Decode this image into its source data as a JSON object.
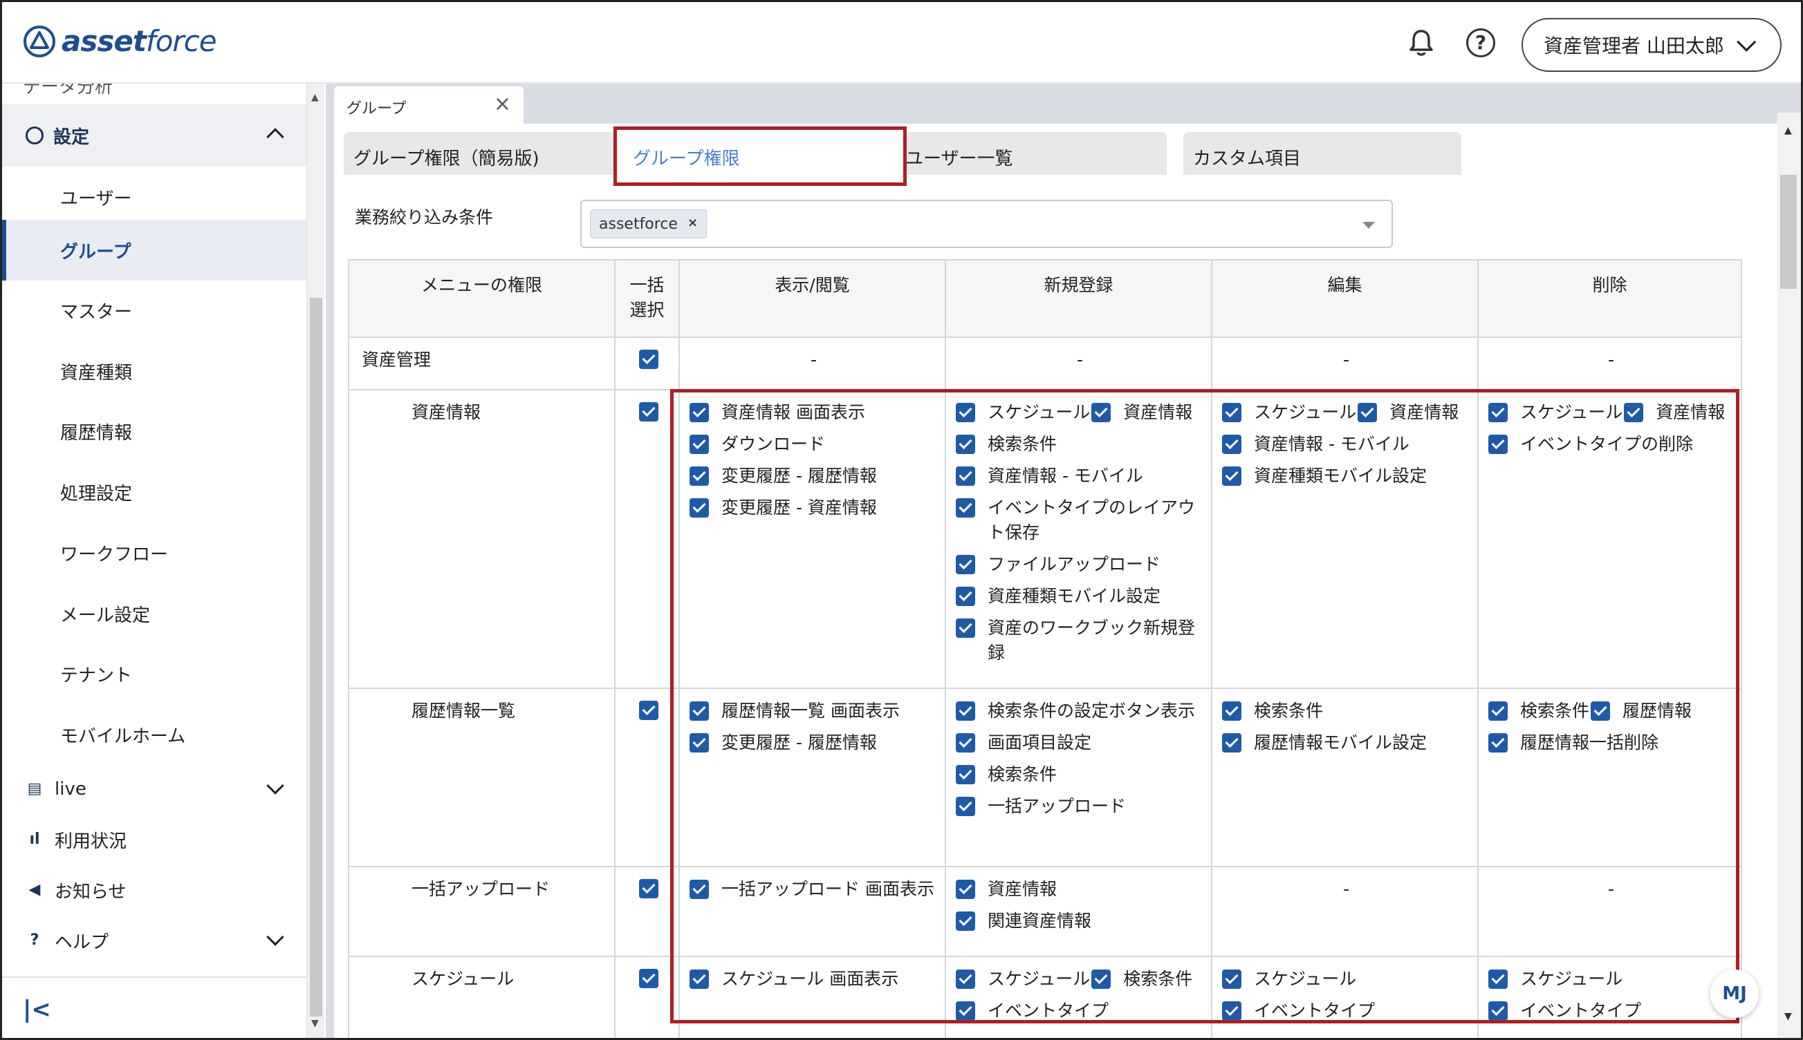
{
  "header": {
    "logo_bold": "asset",
    "logo_light": "force",
    "bell_icon": "bell-icon",
    "help_icon": "question-circle-icon",
    "help_glyph": "?",
    "user_label": "資産管理者 山田太郎"
  },
  "sidebar": {
    "cut_item": "データ分析",
    "settings_label": "設定",
    "sub_items": [
      "ユーザー",
      "グループ",
      "マスター",
      "資産種類",
      "履歴情報",
      "処理設定",
      "ワークフロー",
      "メール設定",
      "テナント",
      "モバイルホーム"
    ],
    "active_sub": "グループ",
    "main_items": [
      {
        "label": "live",
        "icon": "chat-icon",
        "glyph": "▤",
        "has_chevron": true
      },
      {
        "label": "利用状況",
        "icon": "bar-chart-icon",
        "glyph": "ıl",
        "has_chevron": false
      },
      {
        "label": "お知らせ",
        "icon": "megaphone-icon",
        "glyph": "◀",
        "has_chevron": false
      },
      {
        "label": "ヘルプ",
        "icon": "help-circle-icon",
        "glyph": "?",
        "has_chevron": true
      }
    ],
    "collapse_glyph": "|<"
  },
  "doc_tab": {
    "label": "グループ",
    "close": "×"
  },
  "sub_tabs": [
    {
      "label": "グループ権限（簡易版)",
      "active": false
    },
    {
      "label": "グループ権限",
      "active": true
    },
    {
      "label": "ユーザー一覧",
      "active": false
    },
    {
      "label": "カスタム項目",
      "active": false
    }
  ],
  "filter": {
    "label": "業務絞り込み条件",
    "chip": "assetforce",
    "chip_close": "×"
  },
  "table": {
    "headers": [
      "メニューの権限",
      "一括選択",
      "表示/閲覧",
      "新規登録",
      "編集",
      "削除"
    ],
    "rows": [
      {
        "name": "資産管理",
        "bulk": true,
        "view": "-",
        "create": "-",
        "edit": "-",
        "delete": "-"
      },
      {
        "name": "資産情報",
        "bulk": true,
        "view": [
          "資産情報 画面表示",
          "ダウンロード",
          "変更履歴 - 履歴情報",
          "変更履歴 - 資産情報"
        ],
        "create_pair": [
          "スケジュール",
          "資産情報"
        ],
        "create": [
          "検索条件",
          "資産情報 - モバイル",
          "イベントタイプのレイアウト保存",
          "ファイルアップロード",
          "資産種類モバイル設定",
          "資産のワークブック新規登録"
        ],
        "edit_pair": [
          "スケジュール",
          "資産情報"
        ],
        "edit": [
          "資産情報 - モバイル",
          "資産種類モバイル設定"
        ],
        "delete_pair": [
          "スケジュール",
          "資産情報"
        ],
        "delete": [
          "イベントタイプの削除"
        ]
      },
      {
        "name": "履歴情報一覧",
        "bulk": true,
        "view": [
          "履歴情報一覧 画面表示",
          "変更履歴 - 履歴情報"
        ],
        "create": [
          "検索条件の設定ボタン表示",
          "画面項目設定",
          "検索条件",
          "一括アップロード"
        ],
        "edit": [
          "検索条件",
          "履歴情報モバイル設定"
        ],
        "delete_pair": [
          "検索条件",
          "履歴情報"
        ],
        "delete": [
          "履歴情報一括削除"
        ]
      },
      {
        "name": "一括アップロード",
        "bulk": true,
        "view": [
          "一括アップロード 画面表示"
        ],
        "create": [
          "資産情報",
          "関連資産情報"
        ],
        "edit": "-",
        "delete": "-"
      },
      {
        "name": "スケジュール",
        "bulk": true,
        "view": [
          "スケジュール 画面表示"
        ],
        "create_pair": [
          "スケジュール",
          "検索条件"
        ],
        "create": [
          "イベントタイプ"
        ],
        "edit": [
          "スケジュール",
          "イベントタイプ"
        ],
        "delete": [
          "スケジュール",
          "イベントタイプ"
        ]
      }
    ]
  },
  "fab_label": "MJ",
  "colors": {
    "brand": "#1d4f8f",
    "checkbox": "#1f5aa8",
    "highlight": "#b01e23",
    "active_tab_text": "#4a7fd0"
  }
}
